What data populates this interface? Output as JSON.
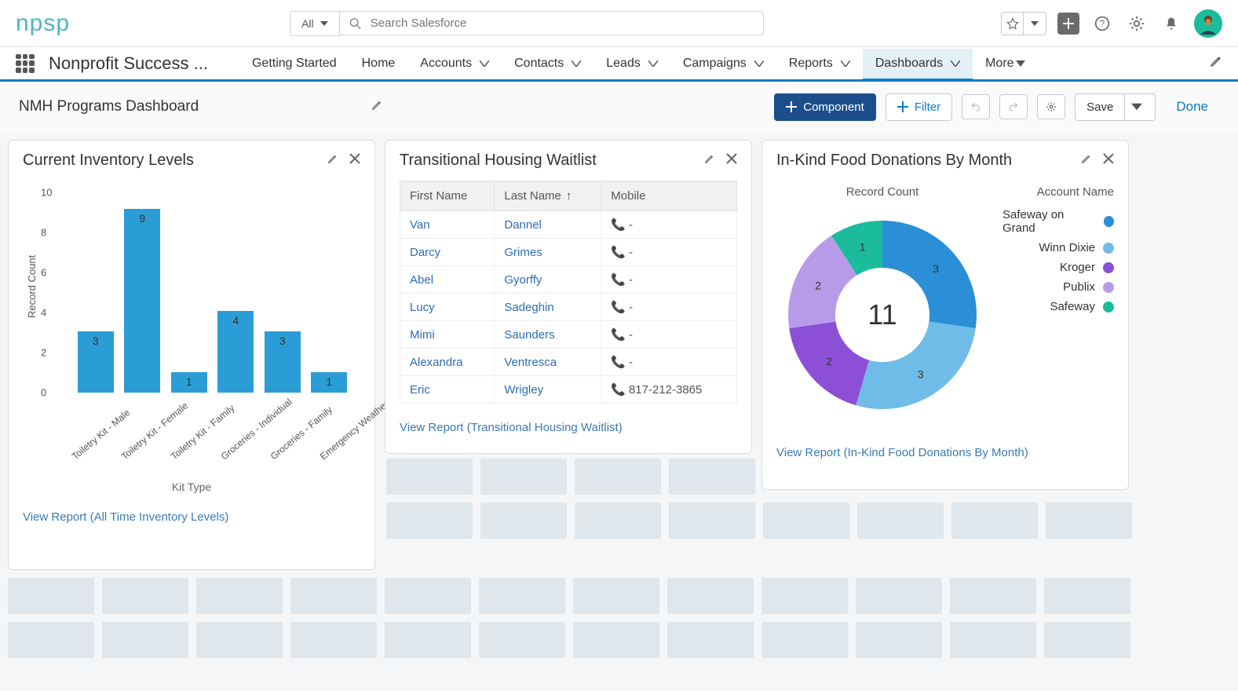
{
  "logo_text": "npsp",
  "search": {
    "scope": "All",
    "placeholder": "Search Salesforce"
  },
  "header_icons": {
    "star": "star-icon",
    "dropdown": "chevron-down-icon",
    "plus": "plus-icon",
    "help": "question-icon",
    "gear": "gear-icon",
    "bell": "bell-icon",
    "avatar": "avatar"
  },
  "app_name": "Nonprofit Success ...",
  "nav": {
    "items": [
      "Getting Started",
      "Home",
      "Accounts",
      "Contacts",
      "Leads",
      "Campaigns",
      "Reports",
      "Dashboards",
      "More"
    ],
    "active": "Dashboards"
  },
  "toolbar": {
    "dashboard_title": "NMH Programs Dashboard",
    "component_btn": "Component",
    "filter_btn": "Filter",
    "save_btn": "Save",
    "done_btn": "Done"
  },
  "cards": {
    "inventory": {
      "title": "Current Inventory Levels",
      "yaxis": "Record Count",
      "xaxis": "Kit Type",
      "footer": "View Report (All Time Inventory Levels)"
    },
    "waitlist": {
      "title": "Transitional Housing Waitlist",
      "columns": {
        "first": "First Name",
        "last": "Last Name",
        "mobile": "Mobile"
      },
      "rows": [
        {
          "first": "Van",
          "last": "Dannel",
          "mobile": "-"
        },
        {
          "first": "Darcy",
          "last": "Grimes",
          "mobile": "-"
        },
        {
          "first": "Abel",
          "last": "Gyorffy",
          "mobile": "-"
        },
        {
          "first": "Lucy",
          "last": "Sadeghin",
          "mobile": "-"
        },
        {
          "first": "Mimi",
          "last": "Saunders",
          "mobile": "-"
        },
        {
          "first": "Alexandra",
          "last": "Ventresca",
          "mobile": "-"
        },
        {
          "first": "Eric",
          "last": "Wrigley",
          "mobile": "817-212-3865"
        }
      ],
      "footer": "View Report (Transitional Housing Waitlist)"
    },
    "donations": {
      "title": "In-Kind Food Donations By Month",
      "center_label": "Record Count",
      "legend_title": "Account Name",
      "footer": "View Report (In-Kind Food Donations By Month)"
    }
  },
  "chart_data": [
    {
      "type": "bar",
      "title": "Current Inventory Levels",
      "xlabel": "Kit Type",
      "ylabel": "Record Count",
      "ylim": [
        0,
        10
      ],
      "yticks": [
        0,
        2,
        4,
        6,
        8,
        10
      ],
      "categories": [
        "Toiletry Kit - Male",
        "Toiletry Kit - Female",
        "Toiletry Kit - Family",
        "Groceries - Individual",
        "Groceries - Family",
        "Emergency Weather Kit"
      ],
      "values": [
        3,
        9,
        1,
        4,
        3,
        1
      ]
    },
    {
      "type": "pie",
      "title": "In-Kind Food Donations By Month",
      "center_total": 11,
      "center_label": "Record Count",
      "series": [
        {
          "name": "Safeway on Grand",
          "value": 3,
          "color": "#2a8fd6"
        },
        {
          "name": "Winn Dixie",
          "value": 3,
          "color": "#6fbce8"
        },
        {
          "name": "Kroger",
          "value": 2,
          "color": "#8c4fd6"
        },
        {
          "name": "Publix",
          "value": 2,
          "color": "#b89be8"
        },
        {
          "name": "Safeway",
          "value": 1,
          "color": "#1abc9c"
        }
      ]
    }
  ]
}
